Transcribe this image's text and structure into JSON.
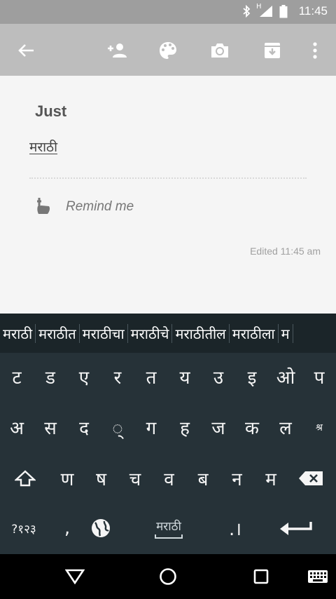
{
  "status_bar": {
    "time": "11:45",
    "network_indicator": "H",
    "icons": [
      "bluetooth-icon",
      "signal-icon",
      "battery-icon"
    ]
  },
  "toolbar": {
    "icons": [
      "back-arrow-icon",
      "add-collaborator-icon",
      "palette-icon",
      "camera-icon",
      "archive-icon",
      "more-vert-icon"
    ]
  },
  "note": {
    "title": "Just",
    "body": "मराठी",
    "reminder_label": "Remind me",
    "edited": "Edited 11:45 am"
  },
  "keyboard": {
    "suggestions": [
      "मराठी",
      "मराठीत",
      "मराठीचा",
      "मराठीचे",
      "मराठीतील",
      "मराठीला",
      "म"
    ],
    "row1": [
      "ट",
      "ड",
      "ए",
      "र",
      "त",
      "य",
      "उ",
      "इ",
      "ओ",
      "प"
    ],
    "row2": [
      "अ",
      "स",
      "द",
      "्",
      "ग",
      "ह",
      "ज",
      "क",
      "ल",
      "श्र"
    ],
    "row3": [
      "ण",
      "ष",
      "च",
      "व",
      "ब",
      "न",
      "म"
    ],
    "row4": {
      "symbols_label": "?१२३",
      "comma": ",",
      "space_label": "मराठी",
      "period": ".।"
    }
  },
  "colors": {
    "status_bar": "#9e9e9e",
    "toolbar": "#bdbdbd",
    "note_bg": "#f5f5f5",
    "keyboard_bg": "#263238",
    "suggestion_bg": "#1b2529",
    "nav_bar": "#000000"
  },
  "nav_bar": {
    "icons": [
      "back-icon",
      "home-icon",
      "recents-icon",
      "keyboard-switch-icon"
    ]
  }
}
